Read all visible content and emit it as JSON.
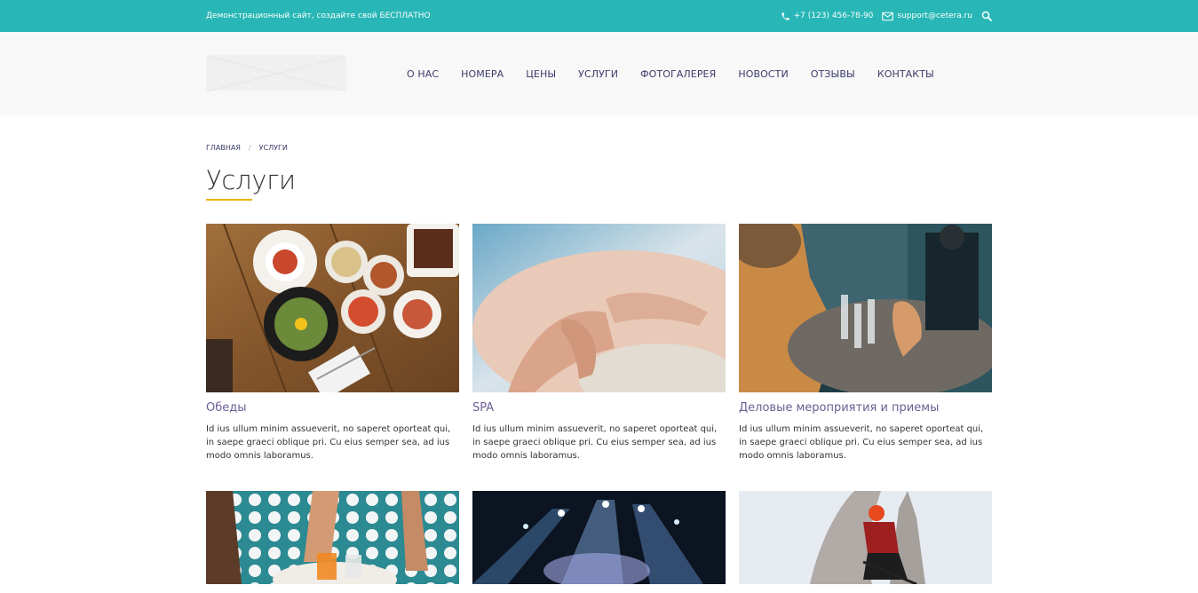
{
  "topbar": {
    "promo": "Демонстрационный сайт, создайте свой БЕСПЛАТНО",
    "phone": "+7 (123) 456-78-90",
    "email": "support@cetera.ru"
  },
  "nav": {
    "items": [
      "О НАС",
      "НОМЕРА",
      "ЦЕНЫ",
      "УСЛУГИ",
      "ФОТОГАЛЕРЕЯ",
      "НОВОСТИ",
      "ОТЗЫВЫ",
      "КОНТАКТЫ"
    ]
  },
  "breadcrumb": {
    "home": "ГЛАВНАЯ",
    "separator": "/",
    "current": "УСЛУГИ"
  },
  "page": {
    "title": "Услуги"
  },
  "cards": [
    {
      "title": "Обеды",
      "desc": "Id ius ullum minim assueverit, no saperet oporteat qui, in saepe graeci oblique pri. Cu eius semper sea, ad ius modo omnis laboramus."
    },
    {
      "title": "SPA",
      "desc": "Id ius ullum minim assueverit, no saperet oporteat qui, in saepe graeci oblique pri. Cu eius semper sea, ad ius modo omnis laboramus."
    },
    {
      "title": "Деловые мероприятия и приемы",
      "desc": "Id ius ullum minim assueverit, no saperet oporteat qui, in saepe graeci oblique pri. Cu eius semper sea, ad ius modo omnis laboramus."
    },
    {
      "title": "",
      "desc": ""
    },
    {
      "title": "",
      "desc": ""
    },
    {
      "title": "",
      "desc": ""
    }
  ],
  "colors": {
    "topbar": "#28b7b6",
    "accent": "#f0b400",
    "nav_text": "#3c3c6a",
    "card_title": "#6d5c94"
  },
  "icons": {
    "phone": "phone-icon",
    "email": "envelope-icon",
    "search": "search-icon"
  }
}
